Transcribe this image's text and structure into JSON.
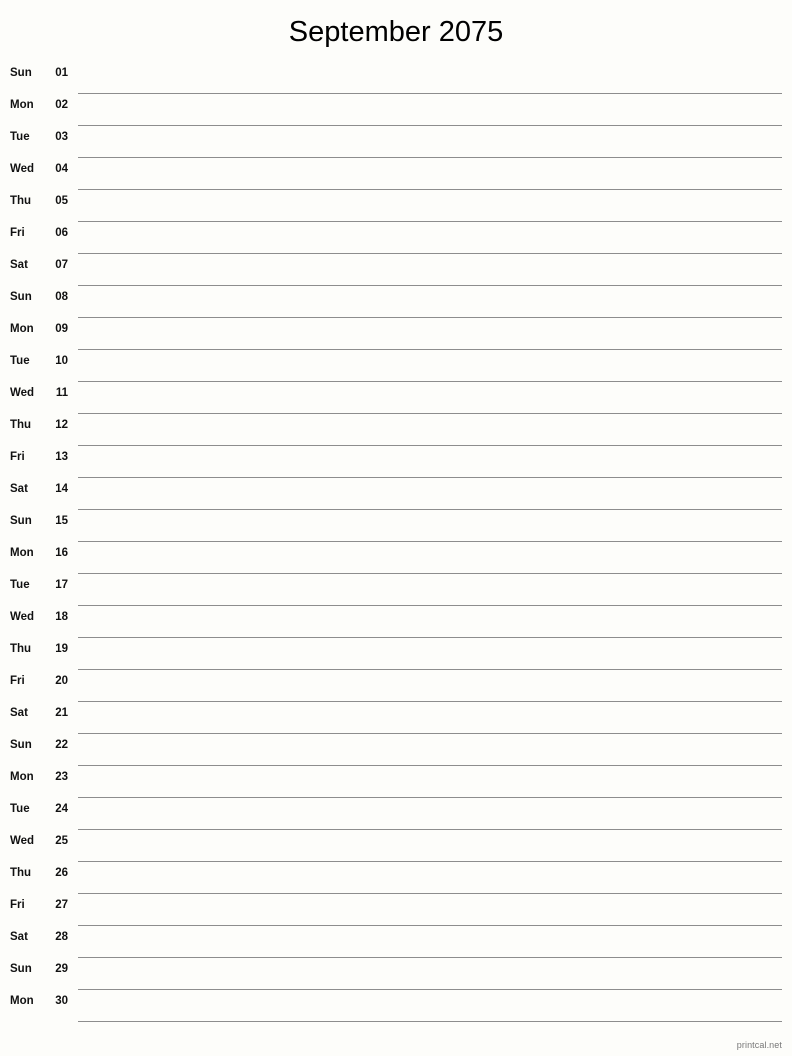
{
  "document": {
    "title": "September 2075",
    "type": "monthly-notes-calendar",
    "month": "September",
    "year": "2075"
  },
  "footer": {
    "label": "printcal.net"
  },
  "colors": {
    "background": "#fdfdfa",
    "text": "#111111",
    "title": "#000000",
    "rule_line": "#8d8d8d",
    "footer_text": "#787878"
  },
  "days": [
    {
      "weekday": "Sun",
      "date": "01"
    },
    {
      "weekday": "Mon",
      "date": "02"
    },
    {
      "weekday": "Tue",
      "date": "03"
    },
    {
      "weekday": "Wed",
      "date": "04"
    },
    {
      "weekday": "Thu",
      "date": "05"
    },
    {
      "weekday": "Fri",
      "date": "06"
    },
    {
      "weekday": "Sat",
      "date": "07"
    },
    {
      "weekday": "Sun",
      "date": "08"
    },
    {
      "weekday": "Mon",
      "date": "09"
    },
    {
      "weekday": "Tue",
      "date": "10"
    },
    {
      "weekday": "Wed",
      "date": "11"
    },
    {
      "weekday": "Thu",
      "date": "12"
    },
    {
      "weekday": "Fri",
      "date": "13"
    },
    {
      "weekday": "Sat",
      "date": "14"
    },
    {
      "weekday": "Sun",
      "date": "15"
    },
    {
      "weekday": "Mon",
      "date": "16"
    },
    {
      "weekday": "Tue",
      "date": "17"
    },
    {
      "weekday": "Wed",
      "date": "18"
    },
    {
      "weekday": "Thu",
      "date": "19"
    },
    {
      "weekday": "Fri",
      "date": "20"
    },
    {
      "weekday": "Sat",
      "date": "21"
    },
    {
      "weekday": "Sun",
      "date": "22"
    },
    {
      "weekday": "Mon",
      "date": "23"
    },
    {
      "weekday": "Tue",
      "date": "24"
    },
    {
      "weekday": "Wed",
      "date": "25"
    },
    {
      "weekday": "Thu",
      "date": "26"
    },
    {
      "weekday": "Fri",
      "date": "27"
    },
    {
      "weekday": "Sat",
      "date": "28"
    },
    {
      "weekday": "Sun",
      "date": "29"
    },
    {
      "weekday": "Mon",
      "date": "30"
    }
  ]
}
